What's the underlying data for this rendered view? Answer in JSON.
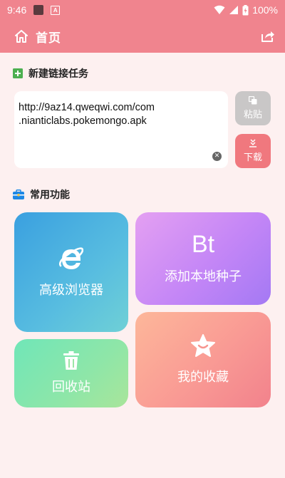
{
  "status_bar": {
    "time": "9:46",
    "battery": "100%"
  },
  "app_bar": {
    "title": "首页",
    "home_icon": "home-icon",
    "share_icon": "share-icon"
  },
  "new_task": {
    "section_title": "新建链接任务",
    "url_value": "http://9az14.qweqwi.com/com\n.nianticlabs.pokemongo.apk",
    "paste_label": "粘贴",
    "download_label": "下载"
  },
  "common": {
    "section_title": "常用功能",
    "cards": [
      {
        "label": "高级浏览器",
        "icon": "browser-e-icon"
      },
      {
        "label": "添加本地种子",
        "icon_text": "Bt"
      },
      {
        "label": "回收站",
        "icon": "trash-icon"
      },
      {
        "label": "我的收藏",
        "icon": "star-icon"
      }
    ]
  },
  "colors": {
    "accent": "#f0848e",
    "background": "#fdf0f0",
    "paste_button": "#c9c7c7",
    "download_button": "#f0787e"
  }
}
